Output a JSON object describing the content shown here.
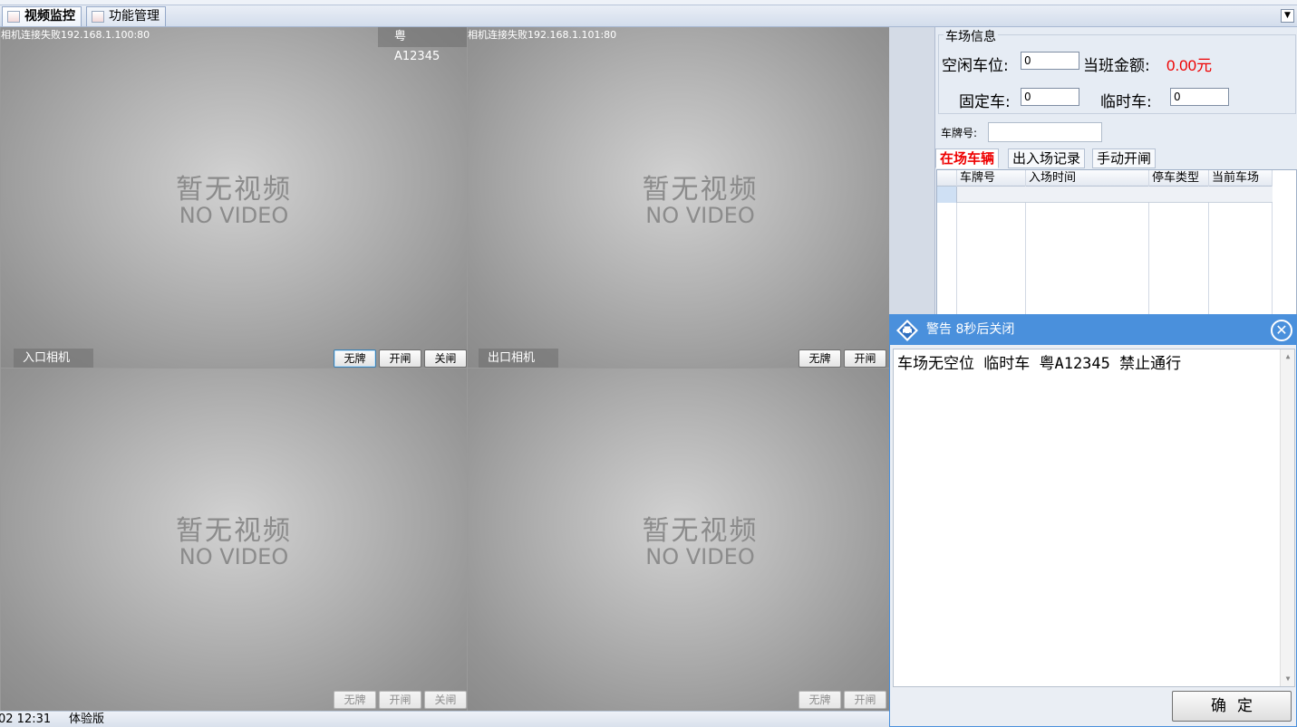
{
  "tabs": [
    {
      "label": "视频监控",
      "active": true
    },
    {
      "label": "功能管理",
      "active": false
    }
  ],
  "video": {
    "no_video_cn": "暂无视频",
    "no_video_en": "NO VIDEO",
    "cells": [
      {
        "status": "相机连接失败192.168.1.100:80",
        "plate": "粤A12345",
        "camera_label": "入口相机",
        "buttons": [
          "无牌",
          "开闸",
          "关闸"
        ]
      },
      {
        "status": "相机连接失败192.168.1.101:80",
        "plate": "",
        "camera_label": "出口相机",
        "buttons": [
          "无牌",
          "开闸"
        ]
      },
      {
        "status": "",
        "plate": "",
        "camera_label": "",
        "buttons": [
          "无牌",
          "开闸",
          "关闸"
        ]
      },
      {
        "status": "",
        "plate": "",
        "camera_label": "",
        "buttons": [
          "无牌",
          "开闸"
        ]
      }
    ]
  },
  "statusbar": {
    "time": "02 12:31",
    "edition": "体验版"
  },
  "lot_info": {
    "title": "车场信息",
    "free_spaces_label": "空闲车位:",
    "free_spaces_value": "0",
    "shift_amount_label": "当班金额:",
    "shift_amount_value": "0.00元",
    "fixed_car_label": "固定车:",
    "fixed_car_value": "0",
    "temp_car_label": "临时车:",
    "temp_car_value": "0"
  },
  "plate_search": {
    "label": "车牌号:",
    "value": ""
  },
  "record_tabs": [
    "在场车辆",
    "出入场记录",
    "手动开闸"
  ],
  "grid": {
    "columns": [
      "车牌号",
      "入场时间",
      "停车类型",
      "当前车场"
    ]
  },
  "dialog": {
    "title": "警告 8秒后关闭",
    "message": "车场无空位 临时车 粤A12345 禁止通行",
    "ok_label": "确定"
  },
  "colors": {
    "accent": "#4a90dc",
    "money": "#ee0000",
    "active_tab": "#ee0000"
  }
}
